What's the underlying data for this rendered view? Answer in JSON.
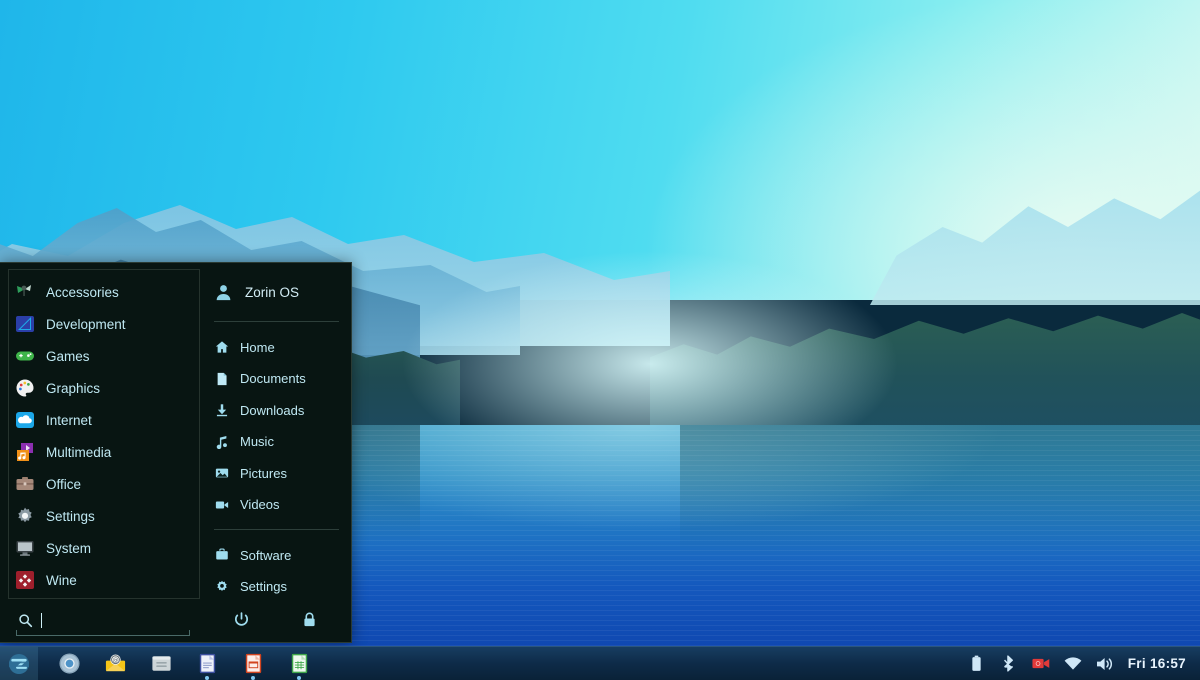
{
  "desktop": {
    "wallpaper_description": "Zorin OS default lake landscape wallpaper",
    "colors": {
      "sky_top": "#1fb6ea",
      "sky_light": "#cdf8f2",
      "water_deep": "#0f47b0",
      "menu_bg": "#081512",
      "menu_text": "#bfe8f2",
      "taskbar_bg": "#0e2b48",
      "taskbar_text": "#e8f4fd"
    }
  },
  "menu": {
    "categories": [
      {
        "label": "Accessories",
        "icon": "accessories-icon"
      },
      {
        "label": "Development",
        "icon": "development-icon"
      },
      {
        "label": "Games",
        "icon": "games-icon"
      },
      {
        "label": "Graphics",
        "icon": "graphics-icon"
      },
      {
        "label": "Internet",
        "icon": "internet-icon"
      },
      {
        "label": "Multimedia",
        "icon": "multimedia-icon"
      },
      {
        "label": "Office",
        "icon": "office-icon"
      },
      {
        "label": "Settings",
        "icon": "settings-icon"
      },
      {
        "label": "System",
        "icon": "system-icon"
      },
      {
        "label": "Wine",
        "icon": "wine-icon"
      }
    ],
    "search": {
      "value": "",
      "placeholder": "",
      "icon": "search-icon"
    },
    "user": {
      "name": "Zorin OS",
      "icon": "user-avatar-icon"
    },
    "places": [
      {
        "label": "Home",
        "icon": "home-icon"
      },
      {
        "label": "Documents",
        "icon": "document-icon"
      },
      {
        "label": "Downloads",
        "icon": "download-icon"
      },
      {
        "label": "Music",
        "icon": "music-note-icon"
      },
      {
        "label": "Pictures",
        "icon": "picture-icon"
      },
      {
        "label": "Videos",
        "icon": "video-camera-icon"
      }
    ],
    "system": [
      {
        "label": "Software",
        "icon": "software-bag-icon"
      },
      {
        "label": "Settings",
        "icon": "gear-icon"
      }
    ],
    "session_buttons": [
      {
        "name": "power-button",
        "icon": "power-icon"
      },
      {
        "name": "lock-button",
        "icon": "lock-icon"
      }
    ]
  },
  "taskbar": {
    "start_button": {
      "label": "Zorin OS Menu",
      "icon": "zorin-logo-icon"
    },
    "apps": [
      {
        "name": "chromium",
        "icon": "chromium-icon",
        "running": false
      },
      {
        "name": "mail",
        "icon": "mail-envelope-icon",
        "running": false
      },
      {
        "name": "file-manager",
        "icon": "file-manager-icon",
        "running": false
      },
      {
        "name": "libreoffice-writer",
        "icon": "writer-icon",
        "running": true
      },
      {
        "name": "libreoffice-impress",
        "icon": "impress-icon",
        "running": true
      },
      {
        "name": "libreoffice-calc",
        "icon": "calc-icon",
        "running": true
      }
    ],
    "tray": [
      {
        "name": "battery",
        "icon": "battery-icon"
      },
      {
        "name": "bluetooth",
        "icon": "bluetooth-icon"
      },
      {
        "name": "screen-recorder",
        "icon": "record-camera-icon"
      },
      {
        "name": "network",
        "icon": "wifi-icon"
      },
      {
        "name": "volume",
        "icon": "volume-icon"
      }
    ],
    "clock": "Fri 16:57"
  }
}
